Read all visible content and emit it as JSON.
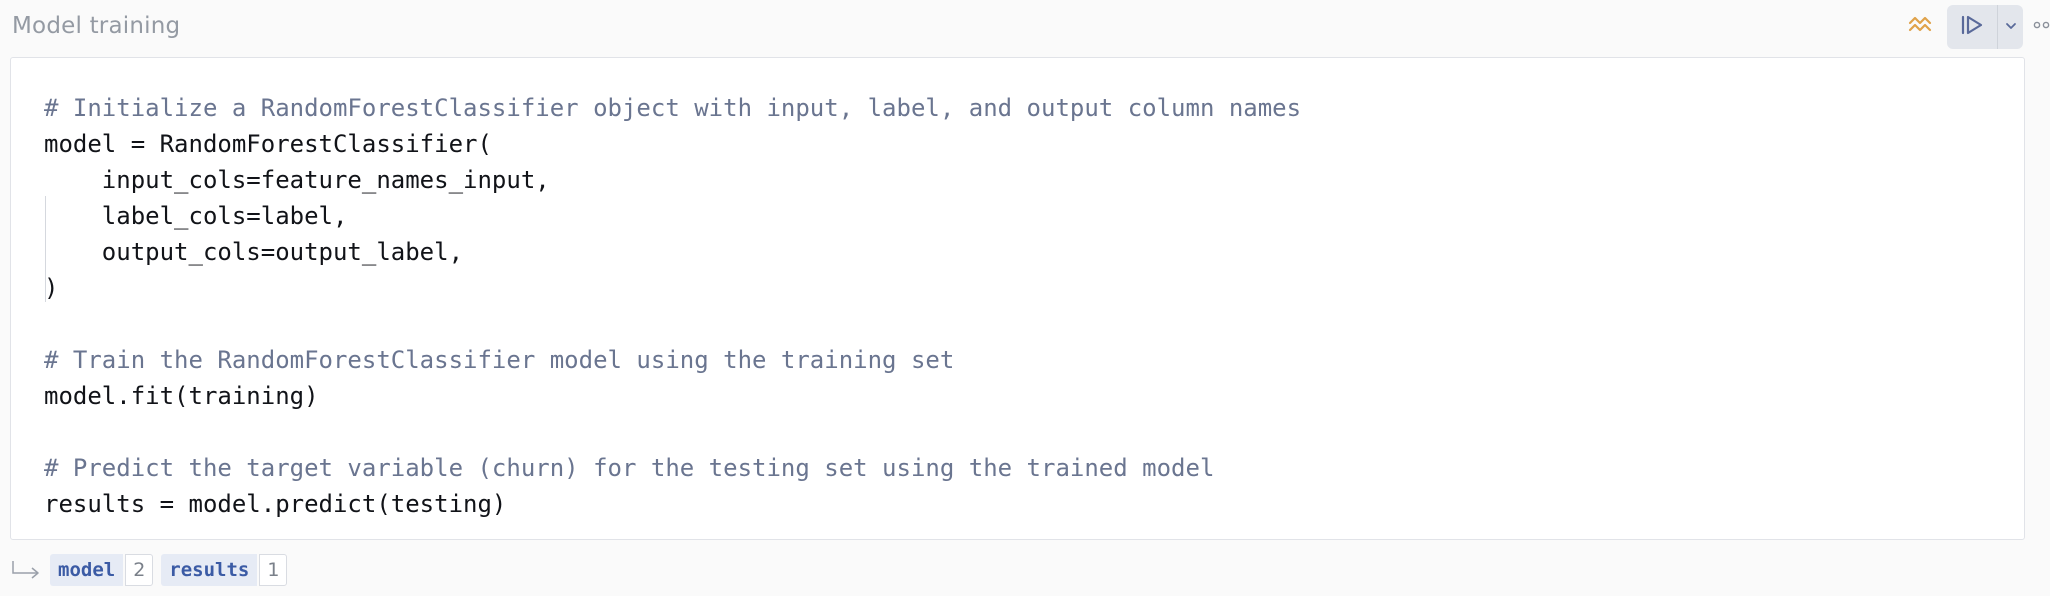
{
  "cell": {
    "title": "Model training"
  },
  "toolbar": {
    "insight_icon": "trend-zigzag-icon",
    "run_icon": "run-play-icon",
    "dropdown_icon": "chevron-down-icon",
    "more_icon": "more-horizontal-icon",
    "colors": {
      "insight": "#e0a24a",
      "run": "#5a6a9a",
      "run_group_bg": "#e3e6ec"
    }
  },
  "code": {
    "lines": [
      {
        "text": "# Initialize a RandomForestClassifier object with input, label, and output column names",
        "type": "comment"
      },
      {
        "text": "model = RandomForestClassifier(",
        "type": "code"
      },
      {
        "text": "    input_cols=feature_names_input,",
        "type": "code"
      },
      {
        "text": "    label_cols=label,",
        "type": "code"
      },
      {
        "text": "    output_cols=output_label,",
        "type": "code"
      },
      {
        "text": ")",
        "type": "code"
      },
      {
        "text": "",
        "type": "blank"
      },
      {
        "text": "# Train the RandomForestClassifier model using the training set",
        "type": "comment"
      },
      {
        "text": "model.fit(training)",
        "type": "code"
      },
      {
        "text": "",
        "type": "blank"
      },
      {
        "text": "# Predict the target variable (churn) for the testing set using the trained model",
        "type": "comment"
      },
      {
        "text": "results = model.predict(testing)",
        "type": "code"
      }
    ],
    "colors": {
      "comment": "#6a7590",
      "code": "#111318"
    }
  },
  "outputs": {
    "return_icon": "return-arrow-icon",
    "variables": [
      {
        "name": "model",
        "count": "2"
      },
      {
        "name": "results",
        "count": "1"
      }
    ]
  }
}
